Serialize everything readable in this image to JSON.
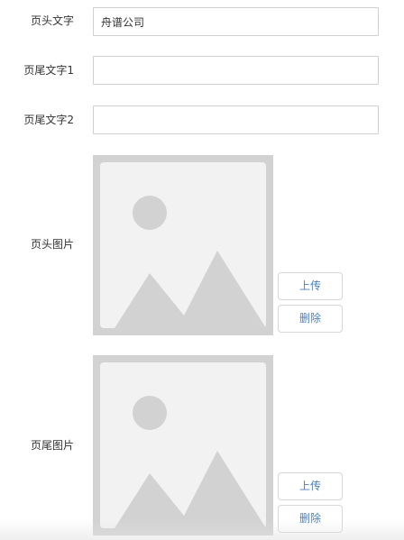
{
  "form": {
    "header_text": {
      "label": "页头文字",
      "value": "舟谱公司",
      "placeholder": ""
    },
    "footer_text_1": {
      "label": "页尾文字1",
      "value": "",
      "placeholder": ""
    },
    "footer_text_2": {
      "label": "页尾文字2",
      "value": "",
      "placeholder": ""
    },
    "header_image": {
      "label": "页头图片",
      "icon": "image-placeholder-icon",
      "upload_label": "上传",
      "delete_label": "删除"
    },
    "footer_image": {
      "label": "页尾图片",
      "icon": "image-placeholder-icon",
      "upload_label": "上传",
      "delete_label": "删除"
    }
  },
  "colors": {
    "button_text": "#4a7fbf",
    "placeholder_gray": "#d2d2d2",
    "placeholder_light": "#f2f2f2"
  }
}
